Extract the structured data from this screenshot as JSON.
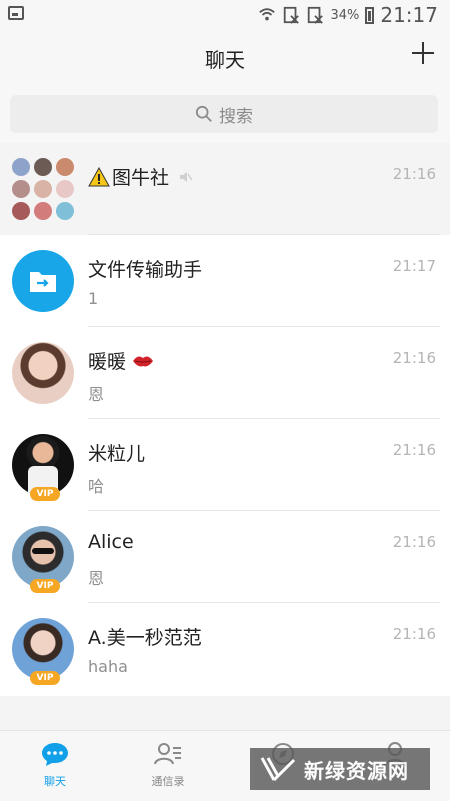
{
  "status_bar": {
    "battery": "34%",
    "time": "21:17"
  },
  "header": {
    "title": "聊天"
  },
  "search": {
    "placeholder": "搜索"
  },
  "chats": [
    {
      "name": "图牛社",
      "preview": "",
      "time": "21:16",
      "badge": ""
    },
    {
      "name": "文件传输助手",
      "preview": "1",
      "time": "21:17",
      "badge": ""
    },
    {
      "name": "暖暖",
      "preview": "恩",
      "time": "21:16",
      "badge": ""
    },
    {
      "name": "米粒儿",
      "preview": "哈",
      "time": "21:16",
      "badge": "VIP"
    },
    {
      "name": "Alice",
      "preview": "恩",
      "time": "21:16",
      "badge": "VIP"
    },
    {
      "name": "A.美一秒范范",
      "preview": "haha",
      "time": "21:16",
      "badge": "VIP"
    }
  ],
  "nav": {
    "chat": "聊天",
    "contacts": "通信录"
  },
  "watermark": "新绿资源网",
  "colors": {
    "accent": "#12a0e8",
    "file_helper": "#19a6e8",
    "vip": "#f5a623"
  }
}
